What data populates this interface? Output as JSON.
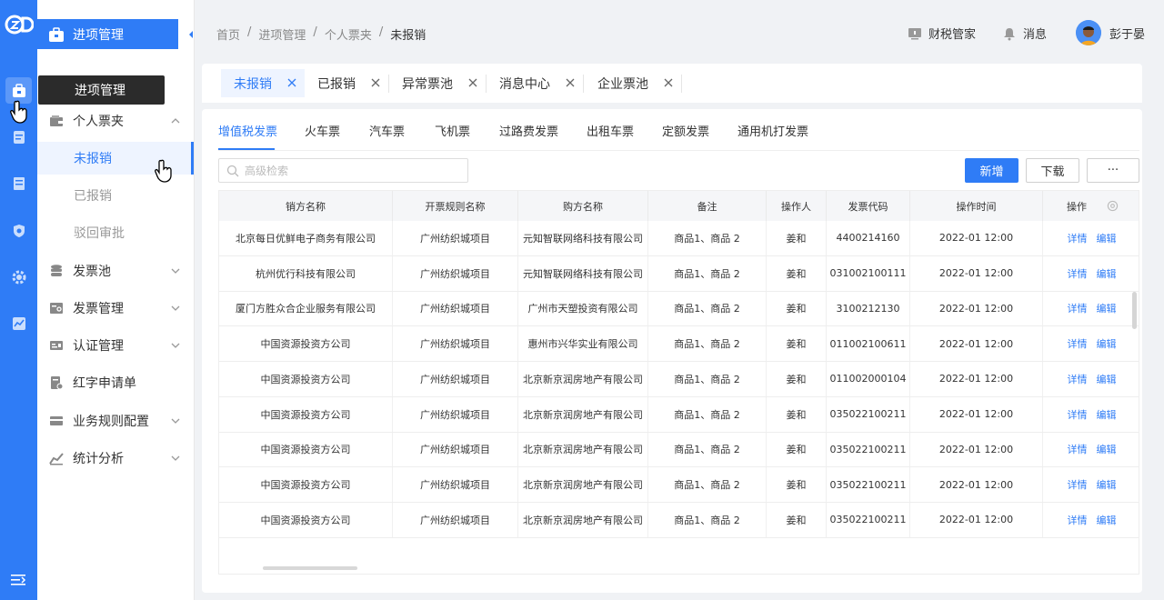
{
  "sidebar": {
    "header": "进项管理",
    "tooltip": "进项管理",
    "items": [
      {
        "label": "个人票夹"
      },
      {
        "label": "发票池"
      },
      {
        "label": "发票管理"
      },
      {
        "label": "认证管理"
      },
      {
        "label": "红字申请单"
      },
      {
        "label": "业务规则配置"
      },
      {
        "label": "统计分析"
      }
    ],
    "sub_items": [
      {
        "label": "未报销"
      },
      {
        "label": "已报销"
      },
      {
        "label": "驳回审批"
      }
    ]
  },
  "breadcrumb": [
    "首页",
    "/",
    "进项管理",
    "/",
    "个人票夹",
    "/",
    "未报销"
  ],
  "topbar": {
    "assistant": "财税管家",
    "messages": "消息",
    "user": "彭于晏"
  },
  "page_tabs": [
    "未报销",
    "已报销",
    "异常票池",
    "消息中心",
    "企业票池"
  ],
  "inner_tabs": [
    "增值税发票",
    "火车票",
    "汽车票",
    "飞机票",
    "过路费发票",
    "出租车票",
    "定额发票",
    "通用机打发票"
  ],
  "search": {
    "placeholder": "高级检索"
  },
  "buttons": {
    "add": "新增",
    "download": "下载",
    "more": "···"
  },
  "table": {
    "headers": [
      "销方名称",
      "开票规则名称",
      "购方名称",
      "备注",
      "操作人",
      "发票代码",
      "操作时间",
      "操作"
    ],
    "rows": [
      [
        "北京每日优鲜电子商务有限公司",
        "广州纺织城项目",
        "元知智联网络科技有限公司",
        "商品1、商品 2",
        "姜和",
        "4400214160",
        "2022-01  12:00"
      ],
      [
        "杭州优行科技有限公司",
        "广州纺织城项目",
        "元知智联网络科技有限公司",
        "商品1、商品 2",
        "姜和",
        "031002100111",
        "2022-01  12:00"
      ],
      [
        "厦门方胜众合企业服务有限公司",
        "广州纺织城项目",
        "广州市天塑投资有限公司",
        "商品1、商品 2",
        "姜和",
        "3100212130",
        "2022-01  12:00"
      ],
      [
        "中国资源投资方公司",
        "广州纺织城项目",
        "惠州市兴华实业有限公司",
        "商品1、商品 2",
        "姜和",
        "011002100611",
        "2022-01  12:00"
      ],
      [
        "中国资源投资方公司",
        "广州纺织城项目",
        "北京新京润房地产有限公司",
        "商品1、商品 2",
        "姜和",
        "011002000104",
        "2022-01  12:00"
      ],
      [
        "中国资源投资方公司",
        "广州纺织城项目",
        "北京新京润房地产有限公司",
        "商品1、商品 2",
        "姜和",
        "035022100211",
        "2022-01  12:00"
      ],
      [
        "中国资源投资方公司",
        "广州纺织城项目",
        "北京新京润房地产有限公司",
        "商品1、商品 2",
        "姜和",
        "035022100211",
        "2022-01  12:00"
      ],
      [
        "中国资源投资方公司",
        "广州纺织城项目",
        "北京新京润房地产有限公司",
        "商品1、商品 2",
        "姜和",
        "035022100211",
        "2022-01  12:00"
      ],
      [
        "中国资源投资方公司",
        "广州纺织城项目",
        "北京新京润房地产有限公司",
        "商品1、商品 2",
        "姜和",
        "035022100211",
        "2022-01  12:00"
      ]
    ],
    "actions": [
      "详情",
      "编辑"
    ]
  },
  "colors": {
    "primary": "#2f7cf6",
    "rail": "#2f7cf6"
  }
}
